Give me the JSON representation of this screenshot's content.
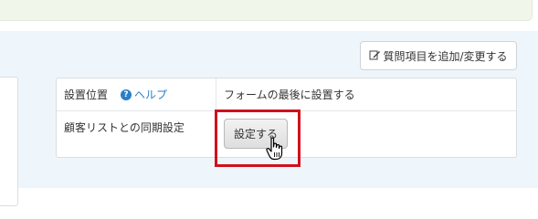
{
  "toolbar": {
    "add_question_label": "質問項目を追加/変更する",
    "add_question_icon": "edit-icon"
  },
  "settings": {
    "rows": [
      {
        "label": "設置位置",
        "help_label": "ヘルプ",
        "value": "フォームの最後に設置する"
      },
      {
        "label": "顧客リストとの同期設定",
        "button_label": "設定する"
      }
    ]
  },
  "colors": {
    "highlight_border": "#d0111c",
    "link": "#2a7fc7",
    "panel_bg": "#eef5fb"
  }
}
